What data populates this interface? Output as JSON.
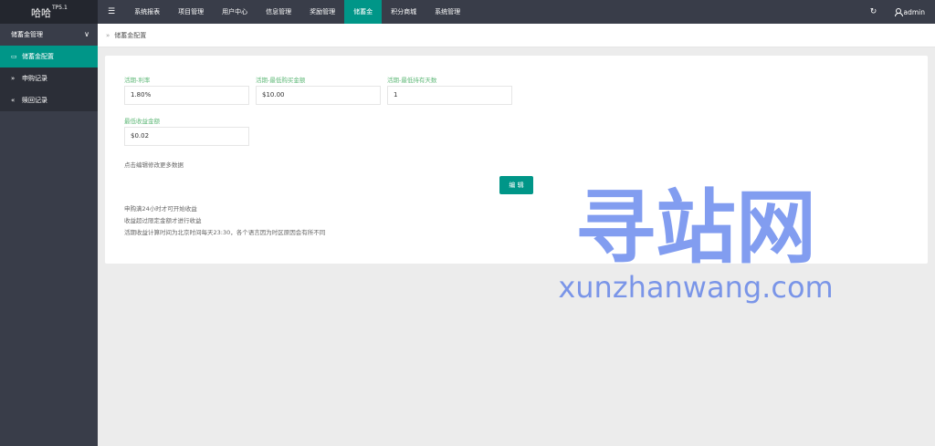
{
  "header": {
    "logo_name": "哈哈",
    "logo_version": "TP5.1",
    "menu_icon": "☰",
    "nav": [
      "系统报表",
      "项目管理",
      "用户中心",
      "信息管理",
      "奖励管理",
      "储蓄金",
      "积分商城",
      "系统管理"
    ],
    "active_nav": "储蓄金",
    "refresh_icon": "refresh-icon",
    "user": "admin"
  },
  "sidebar": {
    "group": "储蓄金管理",
    "items": [
      {
        "icon": "id-card-icon",
        "label": "储蓄金配置",
        "active": true
      },
      {
        "icon": "double-right-icon",
        "label": "申购记录",
        "active": false
      },
      {
        "icon": "double-left-icon",
        "label": "赎回记录",
        "active": false
      }
    ]
  },
  "breadcrumb": {
    "current": "储蓄金配置"
  },
  "form": {
    "fields": [
      {
        "label": "活期-利率",
        "value": "1.80%"
      },
      {
        "label": "活期-最低购买金额",
        "value": "$10.00"
      },
      {
        "label": "活期-最低持有天数",
        "value": "1"
      },
      {
        "label": "最低收益金额",
        "value": "$0.02"
      }
    ],
    "hint": "点击编辑修改更多数据",
    "edit_button": "编 辑",
    "notes": [
      "申购满24小时才可开始收益",
      "收益超过限定金额才进行收益",
      "活期收益计算时间为北京时间每天23:30，各个语言因为时区原因会有所不同"
    ]
  },
  "watermark": {
    "cn": "寻站网",
    "url": "xunzhanwang.com"
  },
  "colors": {
    "accent": "#009688",
    "topbar": "#393d49",
    "label_green": "#5fb878",
    "watermark": "#2f5be6"
  }
}
